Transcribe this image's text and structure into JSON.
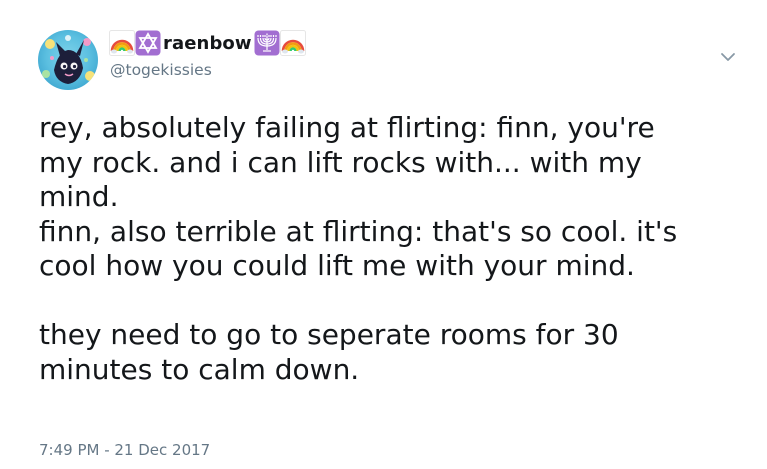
{
  "tweet": {
    "author": {
      "display_name": "raenbow",
      "handle": "@togekissies",
      "name_emojis_before": [
        "rainbow-emoji",
        "star-of-david-emoji"
      ],
      "name_emojis_after": [
        "menorah-emoji",
        "rainbow-emoji"
      ]
    },
    "text_lines": [
      "rey, absolutely failing at flirting: finn, you're",
      "my rock. and i can lift rocks with... with my",
      "mind.",
      "finn, also terrible at flirting: that's so cool. it's",
      "cool how you could lift me with your mind.",
      "",
      "they need to go to seperate rooms for 30",
      "minutes to calm down."
    ],
    "timestamp": "7:49 PM - 21 Dec 2017"
  },
  "colors": {
    "text": "#14171a",
    "secondary_text": "#657786",
    "background": "#ffffff"
  }
}
